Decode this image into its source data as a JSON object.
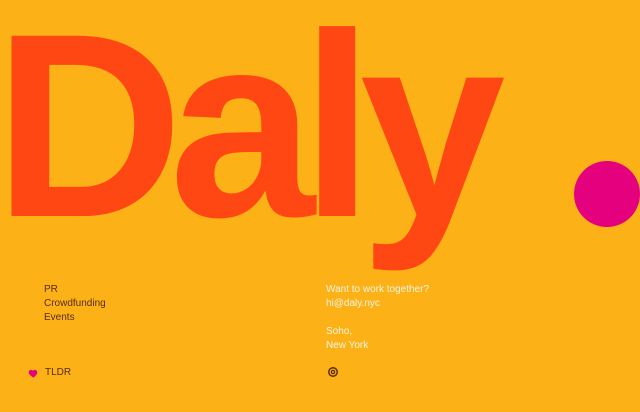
{
  "brand": {
    "wordmark": "Daly",
    "colors": {
      "background": "#FCB217",
      "wordmark": "#FF4713",
      "dot": "#E5007E",
      "dark_text": "#5A2B12",
      "light_text": "#FFF4E0"
    }
  },
  "services": {
    "items": [
      {
        "label": "PR"
      },
      {
        "label": "Crowdfunding"
      },
      {
        "label": "Events"
      }
    ]
  },
  "contact": {
    "cta": "Want to work together?",
    "email": "hi@daly.nyc",
    "address_line_1": "Soho,",
    "address_line_2": "New York"
  },
  "footer": {
    "tldr_label": "TLDR",
    "tldr_icon": "heart-icon",
    "badge_icon": "target-icon"
  }
}
